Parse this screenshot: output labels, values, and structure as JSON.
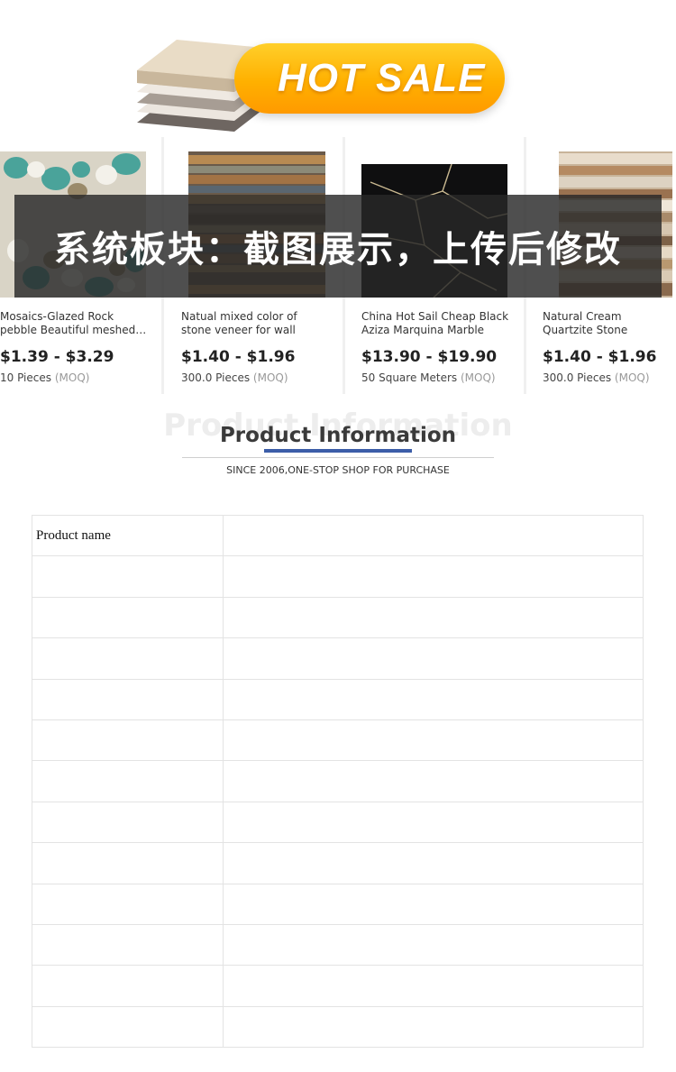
{
  "banner": {
    "text": "HOT SALE",
    "accent": "#ffb000"
  },
  "products": [
    {
      "title": "Mosaics-Glazed Rock pebble Beautiful meshed…",
      "price": "$1.39 - $3.29",
      "moq_qty": "10 Pieces",
      "moq_tag": "(MOQ)",
      "image": "pebble-mosaic"
    },
    {
      "title": "Natual mixed color of stone veneer for wall feature…",
      "price": "$1.40 - $1.96",
      "moq_qty": "300.0 Pieces",
      "moq_tag": "(MOQ)",
      "image": "stone-veneer"
    },
    {
      "title": "China Hot Sail Cheap Black Aziza Marquina Marble Wi…",
      "price": "$13.90 - $19.90",
      "moq_qty": "50 Square Meters",
      "moq_tag": "(MOQ)",
      "image": "black-marble"
    },
    {
      "title": "Natural Cream Quartzite Stone Decoration wall…",
      "price": "$1.40 - $1.96",
      "moq_qty": "300.0 Pieces",
      "moq_tag": "(MOQ)",
      "image": "quartzite-wall"
    }
  ],
  "overlay": {
    "text": "系统板块：截图展示，上传后修改"
  },
  "product_info": {
    "ghost": "Product Information",
    "title": "Product Information",
    "subtitle": "SINCE 2006,ONE-STOP SHOP FOR PURCHASE",
    "accent": "#3c5da8"
  },
  "spec_table": {
    "rows": [
      {
        "key": "Product name",
        "value": ""
      },
      {
        "key": "",
        "value": ""
      },
      {
        "key": "",
        "value": ""
      },
      {
        "key": "",
        "value": ""
      },
      {
        "key": "",
        "value": ""
      },
      {
        "key": "",
        "value": ""
      },
      {
        "key": "",
        "value": ""
      },
      {
        "key": "",
        "value": ""
      },
      {
        "key": "",
        "value": ""
      },
      {
        "key": "",
        "value": ""
      },
      {
        "key": "",
        "value": ""
      },
      {
        "key": "",
        "value": ""
      },
      {
        "key": "",
        "value": ""
      }
    ]
  }
}
